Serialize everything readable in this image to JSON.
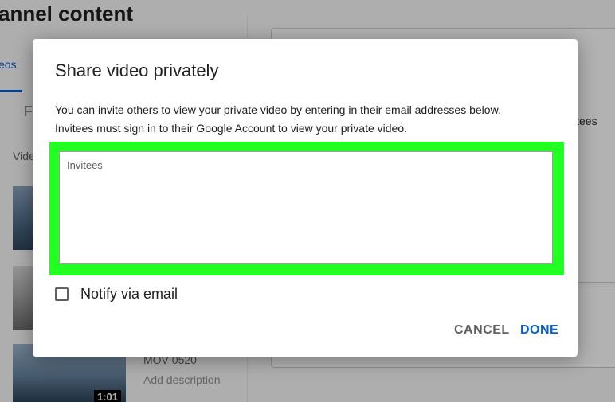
{
  "background": {
    "page_title": "annel content",
    "tab_label": "eos",
    "filter_text": "F",
    "column_header": "Vide",
    "side_text": "itees",
    "video": {
      "title": "MOV 0520",
      "description": "Add description",
      "duration": "1:01"
    }
  },
  "dialog": {
    "title": "Share video privately",
    "description_lines": [
      "You can invite others to view your private video by entering in their email addresses below.",
      "Invitees must sign in to their Google Account to view your private video."
    ],
    "invitees_placeholder": "Invitees",
    "invitees_value": "",
    "notify_label": "Notify via email",
    "notify_checked": false,
    "cancel_label": "CANCEL",
    "done_label": "DONE"
  },
  "colors": {
    "accent": "#065fd4",
    "highlight": "#22ff22",
    "scrim": "rgba(0,0,0,0.30)"
  }
}
